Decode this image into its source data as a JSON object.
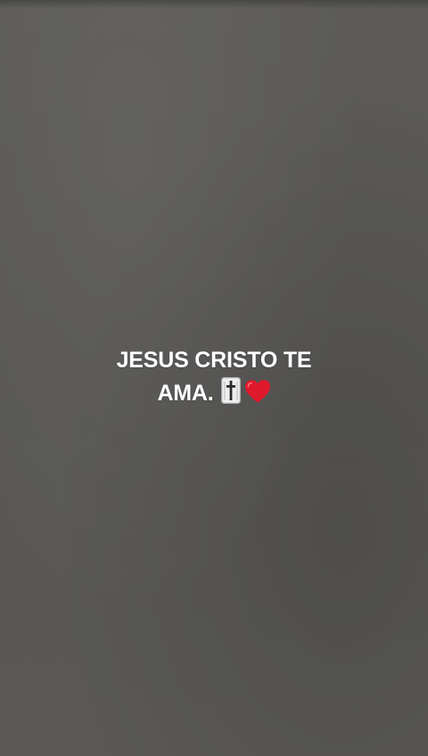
{
  "story": {
    "caption_line1": "JESUS CRISTO TE",
    "caption_line2": "AMA.",
    "emojis": [
      "latin-cross-icon",
      "red-heart-icon"
    ]
  },
  "colors": {
    "background": "#5a5a58",
    "text": "#ffffff",
    "heart": "#e0182b"
  }
}
